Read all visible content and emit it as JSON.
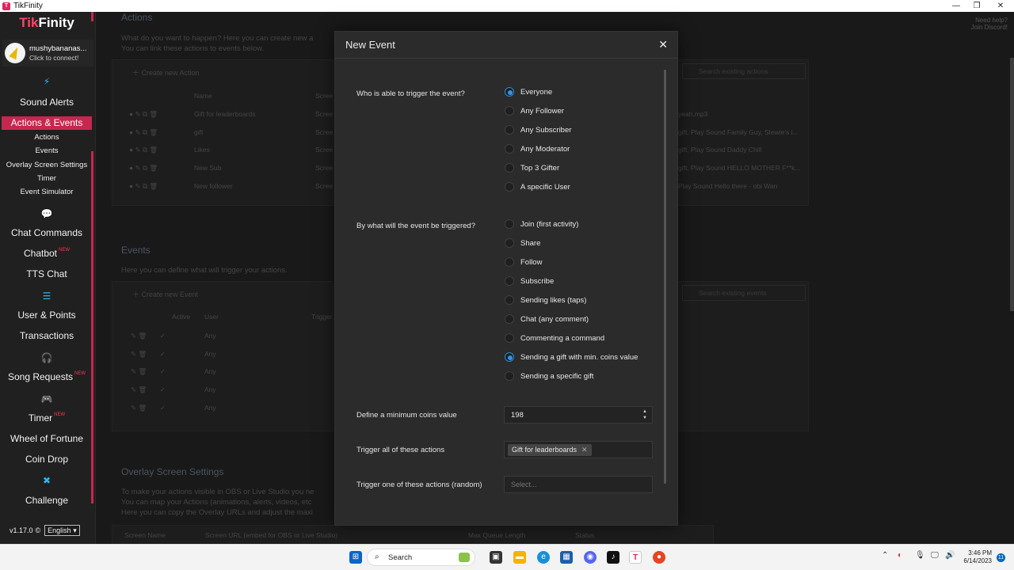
{
  "window": {
    "title": "TikFinity"
  },
  "sidebar": {
    "logo": {
      "tik": "Tik",
      "finity": "Finity"
    },
    "user": {
      "name": "mushybananas...",
      "status": "Click to connect!"
    },
    "items": {
      "sound_alerts": "Sound Alerts",
      "actions_events": "Actions & Events",
      "actions": "Actions",
      "events": "Events",
      "overlay_settings": "Overlay Screen Settings",
      "timer_sub": "Timer",
      "event_simulator": "Event Simulator",
      "chat_commands": "Chat Commands",
      "chatbot": "Chatbot",
      "tts_chat": "TTS Chat",
      "user_points": "User & Points",
      "transactions": "Transactions",
      "song_requests": "Song Requests",
      "timer": "Timer",
      "wheel_of_fortune": "Wheel of Fortune",
      "coin_drop": "Coin Drop",
      "challenge": "Challenge"
    },
    "new_badge": "NEW",
    "version": "v1.17.0",
    "language": "English"
  },
  "main": {
    "actions_title": "Actions",
    "actions_desc_1": "What do you want to happen? Here you can create new a",
    "actions_desc_2": "You can link these actions to events below.",
    "create_action": "Create new Action",
    "actions_header_name": "Name",
    "actions_header_screen": "Scree",
    "actions_rows": [
      "Gift for leaderboards",
      "gift",
      "Likes",
      "New Sub",
      "New follower"
    ],
    "actions_screen_col": "Scree",
    "actions_right": [
      "yeah.mp3",
      "gift, Play Sound Family Guy, Stewie's l...",
      "gift, Play Sound Daddy Chill",
      "gift, Play Sound HELLO MOTHER F**k...",
      "Play Sound Hello there - obi Wan"
    ],
    "search_actions": "Search existing actions",
    "events_title": "Events",
    "events_desc": "Here you can define what will trigger your actions.",
    "create_event": "Create new Event",
    "events_header_active": "Active",
    "events_header_user": "User",
    "events_header_trigger": "Trigger",
    "events_user": "Any",
    "search_events": "Search existing events",
    "overlay_title": "Overlay Screen Settings",
    "overlay_desc_1": "To make your actions visible in OBS or Live Studio you ne",
    "overlay_desc_2": "You can map your Actions (animations, alerts, videos, etc",
    "overlay_desc_3": "Here you can copy the Overlay URLs and adjust the maxi",
    "overlay_footer_1": "Screen Name",
    "overlay_footer_2": "Screen URL (embed for OBS or Live Studio)",
    "overlay_footer_3": "Max Queue Length",
    "overlay_footer_4": "Status",
    "discord_help_1": "Need help?",
    "discord_help_2": "Join Discord!"
  },
  "modal": {
    "title": "New Event",
    "close": "✕",
    "who_label": "Who is able to trigger the event?",
    "who_options": [
      "Everyone",
      "Any Follower",
      "Any Subscriber",
      "Any Moderator",
      "Top 3 Gifter",
      "A specific User"
    ],
    "who_selected": 0,
    "what_label": "By what will the event be triggered?",
    "what_options": [
      "Join (first activity)",
      "Share",
      "Follow",
      "Subscribe",
      "Sending likes (taps)",
      "Chat (any comment)",
      "Commenting a command",
      "Sending a gift with min. coins value",
      "Sending a specific gift"
    ],
    "what_selected": 7,
    "min_coins_label": "Define a minimum coins value",
    "min_coins_value": "198",
    "trigger_all_label": "Trigger all of these actions",
    "trigger_all_tag": "Gift for leaderboards",
    "trigger_one_label": "Trigger one of these actions (random)",
    "trigger_one_placeholder": "Select..."
  },
  "taskbar": {
    "search": "Search",
    "time": "3:46 PM",
    "date": "6/14/2023",
    "notifications": "11"
  },
  "colors": {
    "accent": "#c5284f",
    "radio_selected": "#2f95ea",
    "icon_blue": "#29b6f6"
  }
}
